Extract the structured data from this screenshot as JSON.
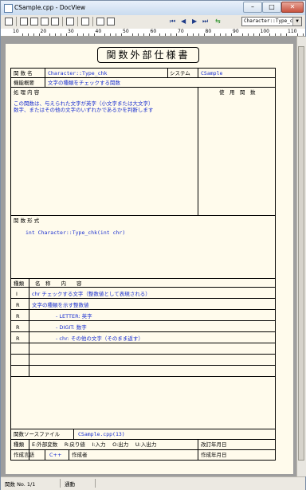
{
  "window": {
    "title": "CSample.cpp - DocView",
    "min": "–",
    "max": "□",
    "close": "✕"
  },
  "toolbar": {
    "nav_first": "⏮",
    "nav_prev": "◀",
    "nav_next": "▶",
    "nav_last": "⏭",
    "nav_link": "⇆",
    "function_select": "Character::Type_ch"
  },
  "ruler": {
    "marks": [
      "10",
      "20",
      "30",
      "40",
      "50",
      "60",
      "70",
      "80",
      "90",
      "100",
      "110"
    ]
  },
  "doc": {
    "title": "関数外部仕様書",
    "func_name_label": "関 数 名",
    "func_name": "Character::Type_chk",
    "system_label": "システム",
    "system": "CSample",
    "summary_label": "機能概要",
    "summary": "文字の種類をチェックする関数",
    "process_label": "処 理 内 容",
    "process_line1": "この関数は、与えられた文字が英字（小文字または大文字）",
    "process_line2": "数字、またはその他の文字のいずれかであるかを判断します",
    "used_label": "使　用　関　数",
    "form_label": "関 数 形 式",
    "form": "int Character::Type_chk(int chr)",
    "param_kind_label": "種類",
    "param_name_label": "名　称　　内　　容",
    "params": [
      {
        "kind": "I",
        "desc": "chr チェックする文字（整数値として表現される）"
      },
      {
        "kind": "R",
        "desc": "文字の種類を示す整数値"
      },
      {
        "kind": "R",
        "desc": "- LETTER: 英字"
      },
      {
        "kind": "R",
        "desc": "- DIGIT: 数字"
      },
      {
        "kind": "R",
        "desc": "- chr: その他の文字（そのまま返す）"
      }
    ],
    "source_label": "関数ソースファイル",
    "source": "CSample.cpp(13)",
    "kind_legend_label": "種類",
    "kind_legend": "E:外部変数　 R:戻り値　 I:入力　 O:出力　 U:入出力",
    "revision_label": "改訂年月日",
    "lang_label": "作成言語",
    "lang": "C++",
    "author_label": "作成者",
    "created_label": "作成年月日"
  },
  "status": {
    "page": "関数 No. 1/1",
    "mode": "通動"
  }
}
